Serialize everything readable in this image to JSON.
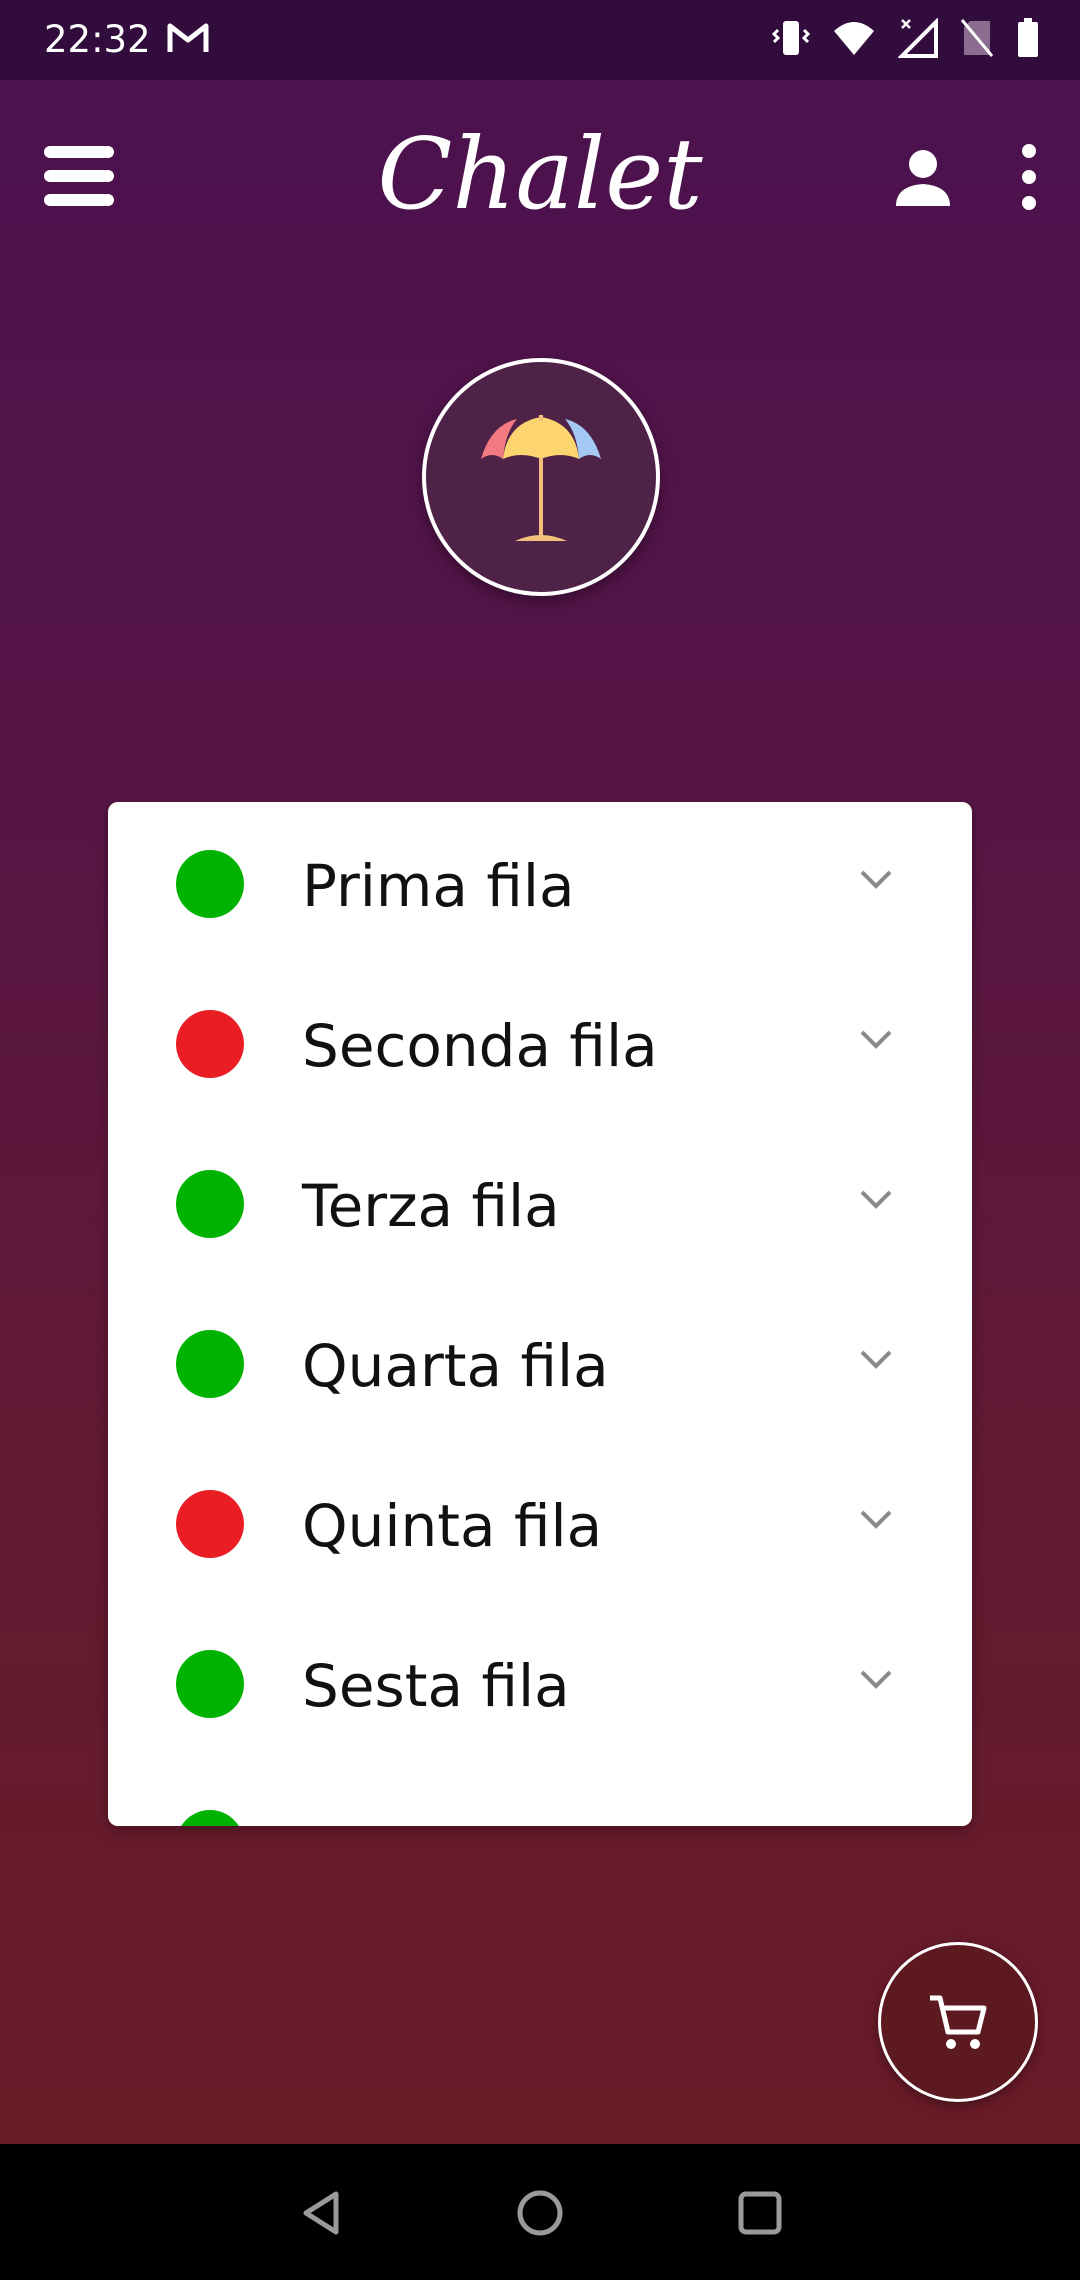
{
  "status_bar": {
    "time": "22:32",
    "icons": [
      "gmail-icon",
      "vibrate-icon",
      "wifi-icon",
      "signal-icon",
      "no-sim-icon",
      "battery-icon"
    ]
  },
  "app_bar": {
    "title": "Chalet",
    "left_icon": "menu-icon",
    "right_icons": [
      "profile-icon",
      "more-vert-icon"
    ]
  },
  "logo": {
    "icon": "beach-umbrella-icon"
  },
  "rows": [
    {
      "label": "Prima fila",
      "status_color": "#00b300"
    },
    {
      "label": "Seconda fila",
      "status_color": "#ea1c24"
    },
    {
      "label": "Terza fila",
      "status_color": "#00b300"
    },
    {
      "label": "Quarta fila",
      "status_color": "#00b300"
    },
    {
      "label": "Quinta fila",
      "status_color": "#ea1c24"
    },
    {
      "label": "Sesta fila",
      "status_color": "#00b300"
    },
    {
      "label": "",
      "status_color": "#00b300"
    }
  ],
  "fab": {
    "icon": "cart-icon"
  },
  "nav_bar": {
    "icons": [
      "back-icon",
      "home-icon",
      "recents-icon"
    ]
  },
  "colors": {
    "status_available": "#00b300",
    "status_full": "#ea1c24",
    "background_top": "#4a1150",
    "background_bottom": "#6a1b24"
  }
}
